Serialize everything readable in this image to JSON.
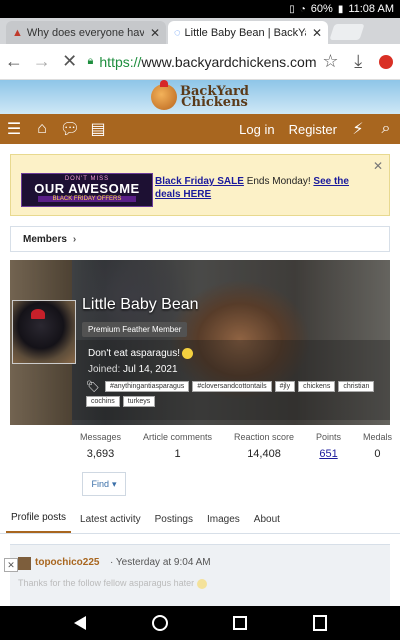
{
  "status_bar": {
    "battery": "60%",
    "time": "11:08 AM"
  },
  "browser": {
    "tabs": [
      {
        "title": "Why does everyone have a"
      },
      {
        "title": "Little Baby Bean | BackYa"
      }
    ],
    "url_scheme": "https://",
    "url_host": "www.backyardchickens.com"
  },
  "site": {
    "logo_line1": "BackYard",
    "logo_line2": "Chickens",
    "nav": {
      "login": "Log in",
      "register": "Register"
    }
  },
  "promo": {
    "ad_line1": "DON'T MISS",
    "ad_line2": "OUR AWESOME",
    "ad_line3": "BLACK FRIDAY OFFERS",
    "sale_bold": "Black Friday SALE",
    "sale_text": " Ends Monday! ",
    "sale_link": "See the deals HERE"
  },
  "breadcrumb": {
    "label": "Members"
  },
  "profile": {
    "name": "Little Baby Bean",
    "title": "Premium Feather Member",
    "status": "Don't eat asparagus!",
    "joined_label": "Joined: ",
    "joined_date": "Jul 14, 2021",
    "tags": [
      "#anythingantiasparagus",
      "#cloversandcottontails",
      "#jly",
      "chickens",
      "christian",
      "cochins",
      "turkeys"
    ]
  },
  "stats": [
    {
      "label": "Messages",
      "value": "3,693"
    },
    {
      "label": "Article comments",
      "value": "1"
    },
    {
      "label": "Reaction score",
      "value": "14,408"
    },
    {
      "label": "Points",
      "value": "651"
    },
    {
      "label": "Medals",
      "value": "0"
    }
  ],
  "find_button": "Find",
  "profile_tabs": [
    "Profile posts",
    "Latest activity",
    "Postings",
    "Images",
    "About"
  ],
  "post": {
    "author": "topochico225",
    "time": "· Yesterday at 9:04 AM",
    "body": "Thanks for the follow fellow asparagus hater "
  },
  "colors": {
    "nav_brown": "#a8661f",
    "promo_bg": "#fcf1c7",
    "link_blue": "#1a1a9c"
  }
}
